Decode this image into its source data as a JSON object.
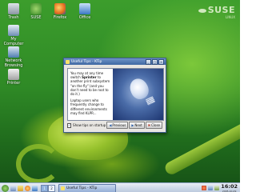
{
  "desktop": {
    "logo": {
      "brand": "SUSE",
      "sub": "LINUX"
    },
    "icons": [
      {
        "label": "Trash",
        "icon": "trash-icon"
      },
      {
        "label": "SUSE",
        "icon": "suse-icon"
      },
      {
        "label": "Firefox",
        "icon": "firefox-icon"
      },
      {
        "label": "Office",
        "icon": "office-icon"
      },
      {
        "label": "My Computer",
        "icon": "computer-icon"
      },
      {
        "label": "Network Browsing",
        "icon": "network-icon"
      },
      {
        "label": "Printer",
        "icon": "printer-icon"
      }
    ]
  },
  "dialog": {
    "title": "Useful Tips - KTip",
    "tip_p1_pre": "You may at any time switch",
    "tip_p1_bold": "Sprinter",
    "tip_p1_post": "to another print subsystem \"on the fly\" (and you don't need to be root to do it.)",
    "tip_p2": "Laptop users who frequently change to different environments may find KLPR...",
    "show_tips_label": "Show tips on startup",
    "show_tips_checked": true,
    "buttons": {
      "previous": "Previous",
      "next": "Next",
      "close": "Close"
    }
  },
  "taskbar": {
    "pager": [
      "1",
      "2"
    ],
    "task_label": "Useful Tips - KTip",
    "clock_time": "16:02",
    "clock_date": "2005-10-09"
  }
}
